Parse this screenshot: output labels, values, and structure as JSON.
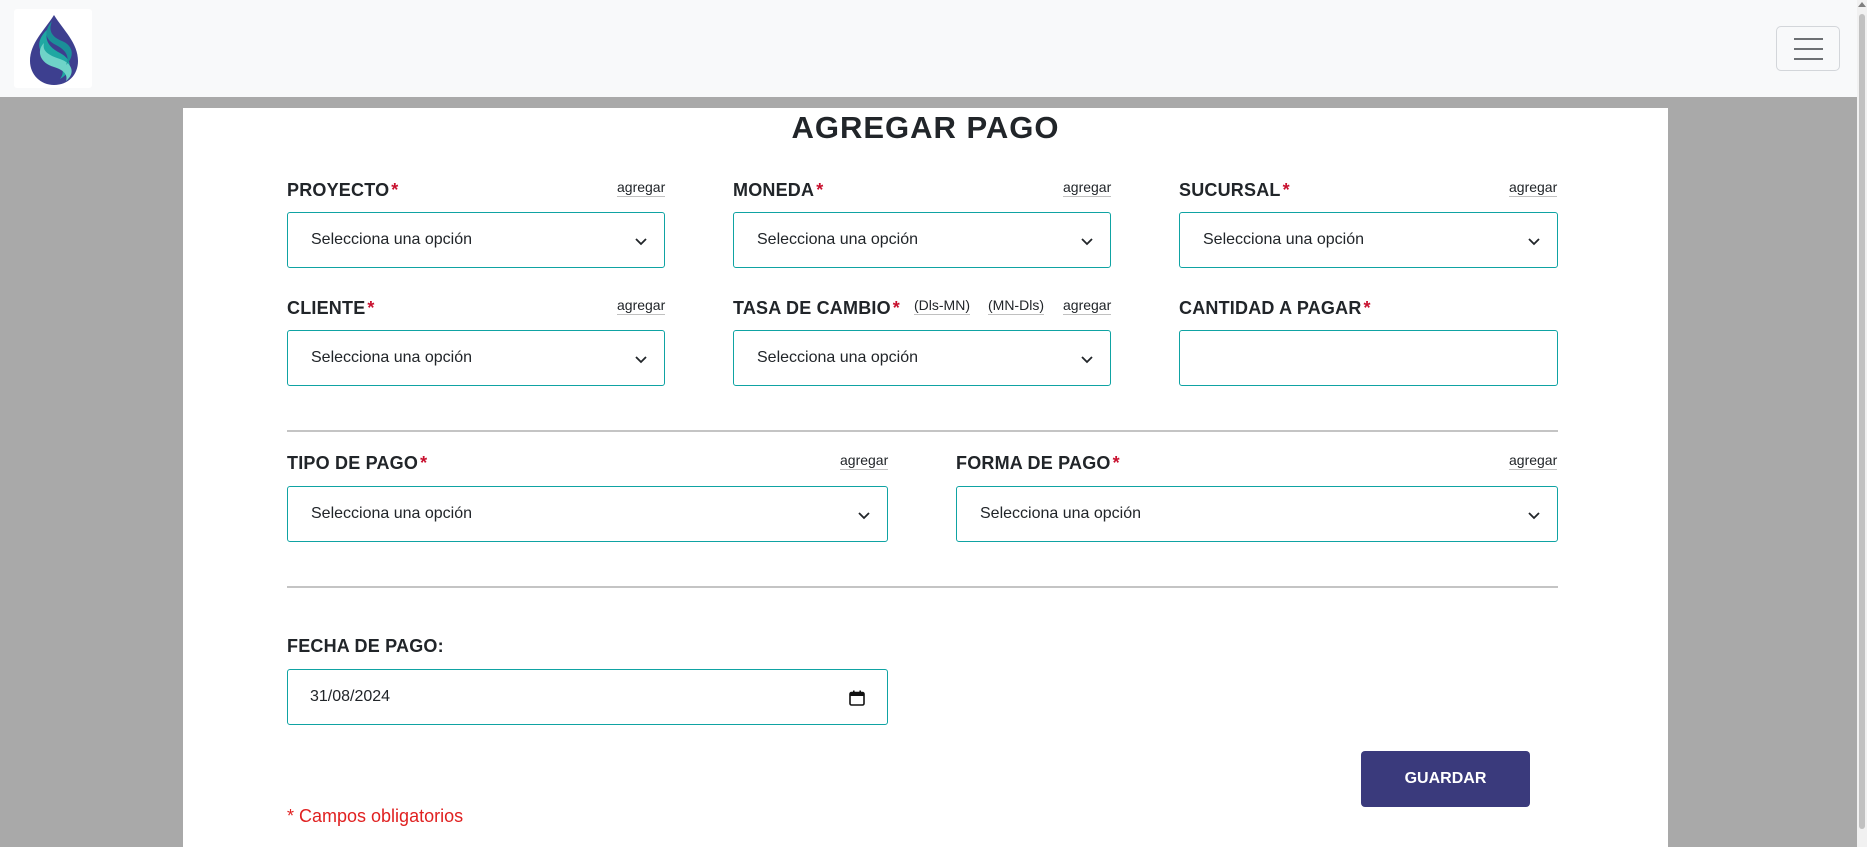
{
  "header": {
    "logo_alt": "logo",
    "menu_icon": "hamburger-menu-icon"
  },
  "form": {
    "title": "AGREGAR PAGO",
    "add_link": "agregar",
    "select_placeholder": "Selecciona una opción",
    "required_mark": "*",
    "fields": {
      "proyecto": {
        "label": "PROYECTO",
        "value": "Selecciona una opción"
      },
      "moneda": {
        "label": "MONEDA",
        "value": "Selecciona una opción"
      },
      "sucursal": {
        "label": "SUCURSAL",
        "value": "Selecciona una opción"
      },
      "cliente": {
        "label": "CLIENTE",
        "value": "Selecciona una opción"
      },
      "tasa_cambio": {
        "label": "TASA DE CAMBIO",
        "value": "Selecciona una opción",
        "option_a": "(Dls-MN)",
        "option_b": "(MN-Dls)"
      },
      "cantidad": {
        "label": "CANTIDAD A PAGAR",
        "value": ""
      },
      "tipo_pago": {
        "label": "TIPO DE PAGO",
        "value": "Selecciona una opción"
      },
      "forma_pago": {
        "label": "FORMA DE PAGO",
        "value": "Selecciona una opción"
      },
      "fecha_pago": {
        "label": "FECHA DE PAGO:",
        "value": "31/08/2024"
      }
    },
    "save_label": "GUARDAR",
    "required_note": "* Campos obligatorios"
  },
  "colors": {
    "accent_border": "#0fa3a3",
    "button": "#3a3a7c",
    "required": "#c8102e",
    "required_note": "#e02020",
    "background": "#a9a9a9"
  }
}
